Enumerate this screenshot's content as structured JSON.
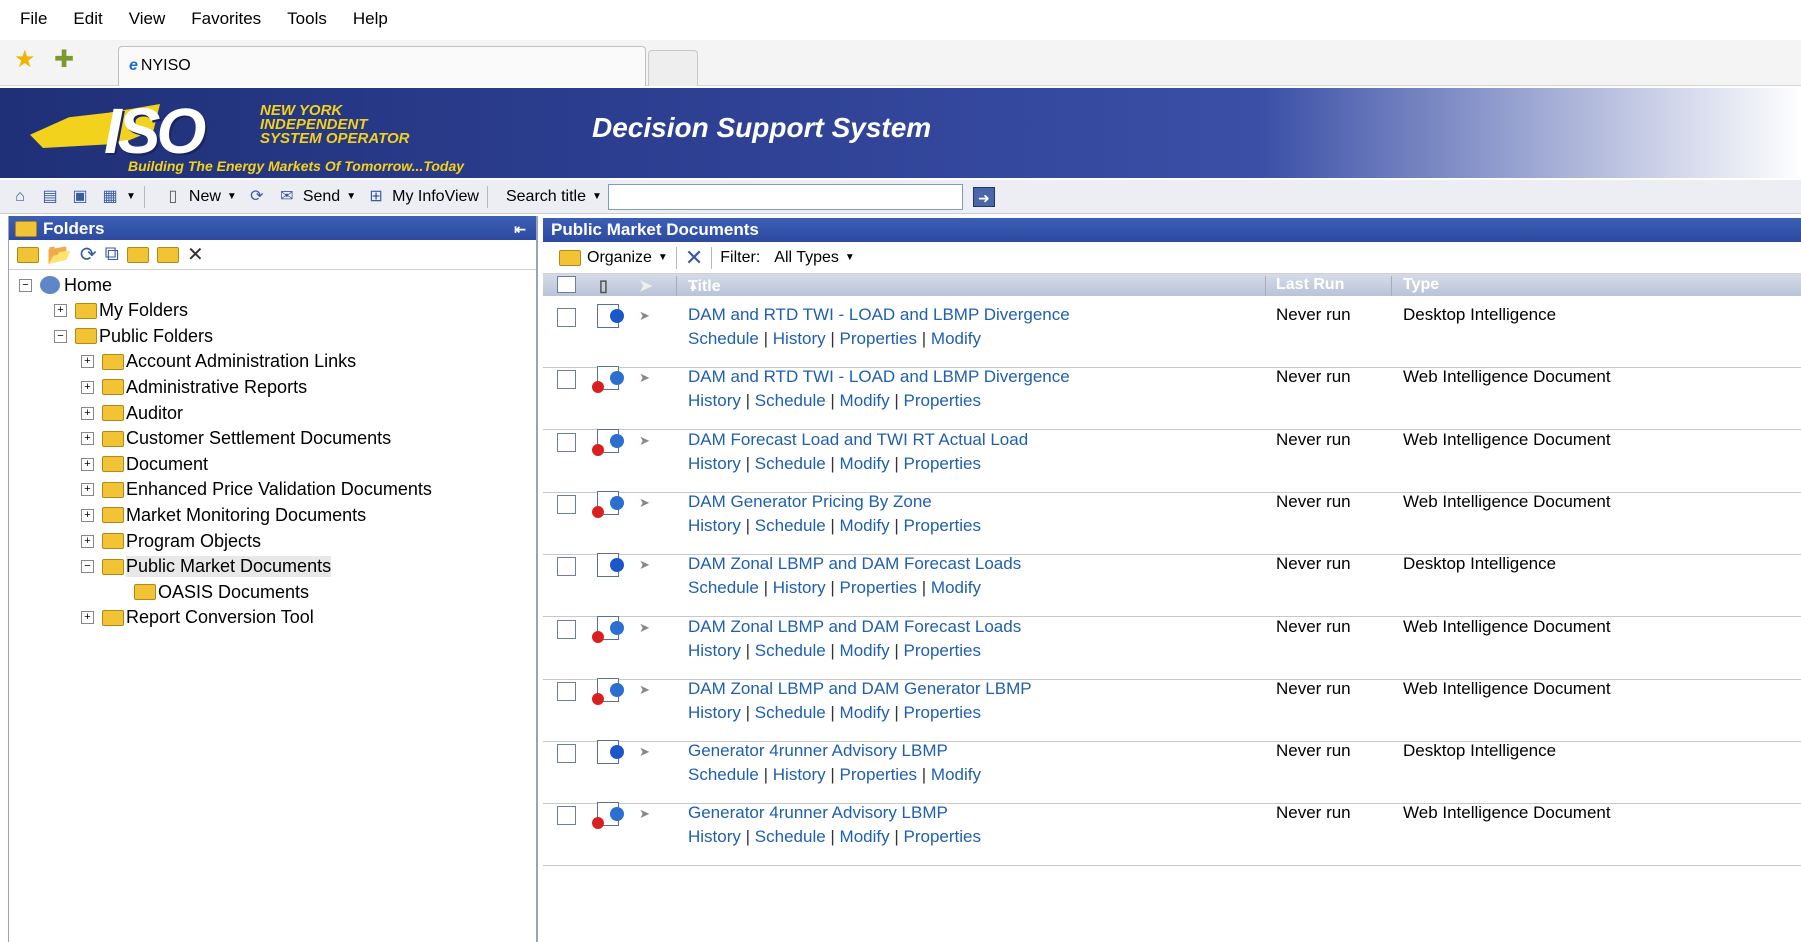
{
  "browser": {
    "menu": [
      "File",
      "Edit",
      "View",
      "Favorites",
      "Tools",
      "Help"
    ],
    "tab_title": "NYISO"
  },
  "banner": {
    "logo_text": "ISO",
    "org_line1": "NEW YORK",
    "org_line2": "INDEPENDENT",
    "org_line3": "SYSTEM OPERATOR",
    "tagline": "Building The Energy Markets Of Tomorrow...Today",
    "app_title": "Decision Support System"
  },
  "toolbar": {
    "new_label": "New",
    "send_label": "Send",
    "myinfoview_label": "My InfoView",
    "search_label": "Search title",
    "search_value": ""
  },
  "left": {
    "header": "Folders",
    "tree": [
      {
        "label": "Home",
        "level": 0,
        "expander": "minus",
        "icon": "home-icon"
      },
      {
        "label": "My Folders",
        "level": 1,
        "expander": "plus",
        "icon": "folder-icon"
      },
      {
        "label": "Public Folders",
        "level": 1,
        "expander": "minus",
        "icon": "folder-icon"
      },
      {
        "label": "Account Administration Links",
        "level": 2,
        "expander": "plus",
        "icon": "folder-icon"
      },
      {
        "label": "Administrative Reports",
        "level": 2,
        "expander": "plus",
        "icon": "folder-icon"
      },
      {
        "label": "Auditor",
        "level": 2,
        "expander": "plus",
        "icon": "folder-icon"
      },
      {
        "label": "Customer Settlement Documents",
        "level": 2,
        "expander": "plus",
        "icon": "folder-icon"
      },
      {
        "label": "Document",
        "level": 2,
        "expander": "plus",
        "icon": "folder-icon"
      },
      {
        "label": "Enhanced Price Validation Documents",
        "level": 2,
        "expander": "plus",
        "icon": "folder-icon"
      },
      {
        "label": "Market Monitoring Documents",
        "level": 2,
        "expander": "plus",
        "icon": "folder-icon"
      },
      {
        "label": "Program Objects",
        "level": 2,
        "expander": "plus",
        "icon": "folder-icon"
      },
      {
        "label": "Public Market Documents",
        "level": 2,
        "expander": "minus",
        "icon": "folder-icon",
        "selected": true
      },
      {
        "label": "OASIS Documents",
        "level": 3,
        "expander": "none",
        "icon": "folder-icon"
      },
      {
        "label": "Report Conversion Tool",
        "level": 2,
        "expander": "plus",
        "icon": "folder-icon"
      }
    ]
  },
  "right": {
    "header": "Public Market Documents",
    "organize_label": "Organize",
    "filter_label": "Filter:",
    "filter_value": "All Types",
    "columns": {
      "title": "Title",
      "last_run": "Last Run",
      "type": "Type"
    },
    "rows": [
      {
        "title": "DAM and RTD TWI - LOAD and LBMP Divergence",
        "links": [
          "Schedule",
          "History",
          "Properties",
          "Modify"
        ],
        "last_run": "Never run",
        "type": "Desktop Intelligence",
        "kind": "desktop"
      },
      {
        "title": "DAM and RTD TWI - LOAD and LBMP Divergence",
        "links": [
          "History",
          "Schedule",
          "Modify",
          "Properties"
        ],
        "last_run": "Never run",
        "type": "Web Intelligence Document",
        "kind": "web"
      },
      {
        "title": "DAM Forecast Load and TWI RT Actual Load",
        "links": [
          "History",
          "Schedule",
          "Modify",
          "Properties"
        ],
        "last_run": "Never run",
        "type": "Web Intelligence Document",
        "kind": "web"
      },
      {
        "title": "DAM Generator Pricing By Zone",
        "links": [
          "History",
          "Schedule",
          "Modify",
          "Properties"
        ],
        "last_run": "Never run",
        "type": "Web Intelligence Document",
        "kind": "web"
      },
      {
        "title": "DAM Zonal LBMP and DAM Forecast Loads",
        "links": [
          "Schedule",
          "History",
          "Properties",
          "Modify"
        ],
        "last_run": "Never run",
        "type": "Desktop Intelligence",
        "kind": "desktop"
      },
      {
        "title": "DAM Zonal LBMP and DAM Forecast Loads",
        "links": [
          "History",
          "Schedule",
          "Modify",
          "Properties"
        ],
        "last_run": "Never run",
        "type": "Web Intelligence Document",
        "kind": "web"
      },
      {
        "title": "DAM Zonal LBMP and DAM Generator LBMP",
        "links": [
          "History",
          "Schedule",
          "Modify",
          "Properties"
        ],
        "last_run": "Never run",
        "type": "Web Intelligence Document",
        "kind": "web"
      },
      {
        "title": "Generator 4runner Advisory LBMP",
        "links": [
          "Schedule",
          "History",
          "Properties",
          "Modify"
        ],
        "last_run": "Never run",
        "type": "Desktop Intelligence",
        "kind": "desktop"
      },
      {
        "title": "Generator 4runner Advisory LBMP",
        "links": [
          "History",
          "Schedule",
          "Modify",
          "Properties"
        ],
        "last_run": "Never run",
        "type": "Web Intelligence Document",
        "kind": "web"
      }
    ]
  }
}
